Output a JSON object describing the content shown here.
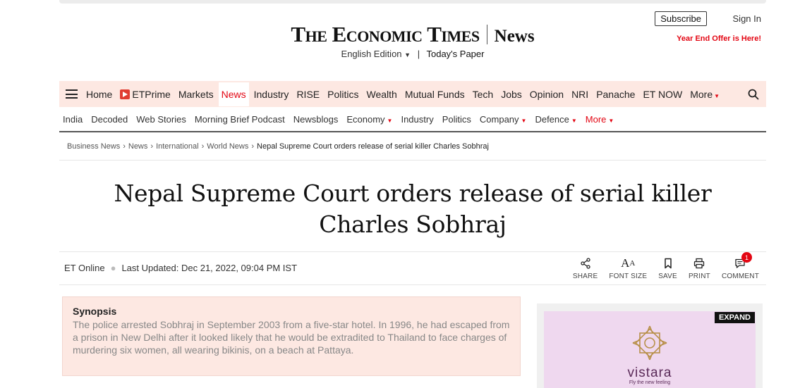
{
  "header": {
    "logo_brand": "The Economic Times",
    "logo_section": "News",
    "edition": "English Edition",
    "todays_paper": "Today's Paper",
    "subscribe": "Subscribe",
    "signin": "Sign In",
    "offer": "Year End Offer is Here!"
  },
  "main_nav": {
    "home": "Home",
    "etprime": "ETPrime",
    "markets": "Markets",
    "news": "News",
    "industry": "Industry",
    "rise": "RISE",
    "politics": "Politics",
    "wealth": "Wealth",
    "mutual_funds": "Mutual Funds",
    "tech": "Tech",
    "jobs": "Jobs",
    "opinion": "Opinion",
    "nri": "NRI",
    "panache": "Panache",
    "etnow": "ET NOW",
    "more": "More"
  },
  "sub_nav": {
    "india": "India",
    "decoded": "Decoded",
    "web_stories": "Web Stories",
    "morning_brief": "Morning Brief Podcast",
    "newsblogs": "Newsblogs",
    "economy": "Economy",
    "industry": "Industry",
    "politics": "Politics",
    "company": "Company",
    "defence": "Defence",
    "more": "More"
  },
  "breadcrumb": {
    "b1": "Business News",
    "b2": "News",
    "b3": "International",
    "b4": "World News",
    "current": "Nepal Supreme Court orders release of serial killer Charles Sobhraj"
  },
  "article": {
    "headline_line1": "Nepal Supreme Court orders release of serial killer",
    "headline_line2": "Charles Sobhraj",
    "author": "ET Online",
    "updated": "Last Updated: Dec 21, 2022, 09:04 PM IST",
    "synopsis_title": "Synopsis",
    "synopsis_text": "The police arrested Sobhraj in September 2003 from a five-star hotel. In 1996, he had escaped from a prison in New Delhi after it looked likely that he would be extradited to Thailand to face charges of murdering six women, all wearing bikinis, on a beach at Pattaya."
  },
  "tools": {
    "share": "SHARE",
    "font_glyph_big": "A",
    "font_glyph_small": "A",
    "font_size": "FONT SIZE",
    "save": "SAVE",
    "print": "PRINT",
    "comment": "COMMENT",
    "comment_count": "1"
  },
  "ad": {
    "expand": "EXPAND",
    "brand": "vistara",
    "tagline": "Fly the new feeling"
  },
  "colors": {
    "accent": "#e30613",
    "nav_bg": "#fde8e2",
    "ad_bg": "#efd8ef",
    "ad_gold": "#b8904a"
  }
}
